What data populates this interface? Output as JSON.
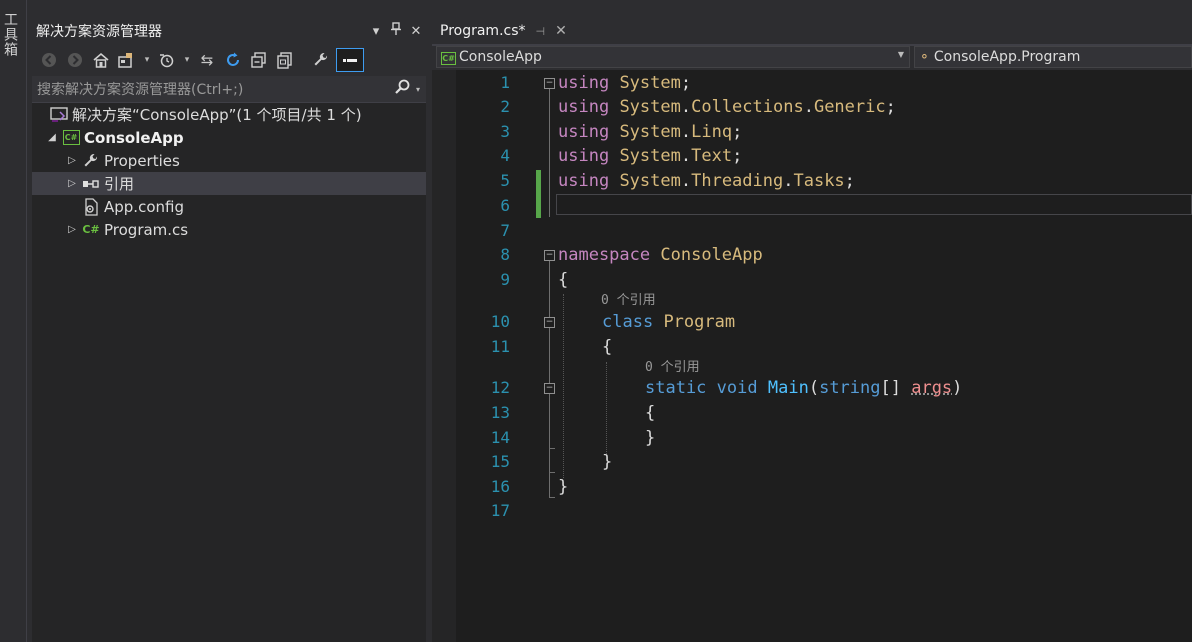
{
  "toolbox": {
    "label": "工具箱"
  },
  "solution_explorer": {
    "title": "解决方案资源管理器",
    "search_placeholder": "搜索解决方案资源管理器(Ctrl+;)",
    "tree": {
      "solution": "解决方案“ConsoleApp”(1 个项目/共 1 个)",
      "project": "ConsoleApp",
      "items": [
        {
          "label": "Properties",
          "icon": "wrench-icon"
        },
        {
          "label": "引用",
          "icon": "references-icon"
        },
        {
          "label": "App.config",
          "icon": "config-file-icon"
        },
        {
          "label": "Program.cs",
          "icon": "csharp-file-icon"
        }
      ]
    }
  },
  "editor": {
    "tab": {
      "label": "Program.cs*"
    },
    "nav": {
      "project": "ConsoleApp",
      "type": "ConsoleApp.Program"
    },
    "line_numbers": [
      "1",
      "2",
      "3",
      "4",
      "5",
      "6",
      "7",
      "8",
      "9",
      "10",
      "11",
      "12",
      "13",
      "14",
      "15",
      "16",
      "17"
    ],
    "code": {
      "l1": [
        "using",
        " ",
        "System",
        ";"
      ],
      "l2": [
        "using",
        " ",
        "System",
        ".",
        "Collections",
        ".",
        "Generic",
        ";"
      ],
      "l3": [
        "using",
        " ",
        "System",
        ".",
        "Linq",
        ";"
      ],
      "l4": [
        "using",
        " ",
        "System",
        ".",
        "Text",
        ";"
      ],
      "l5": [
        "using",
        " ",
        "System",
        ".",
        "Threading",
        ".",
        "Tasks",
        ";"
      ],
      "l8": [
        "namespace",
        " ",
        "ConsoleApp"
      ],
      "l9": "{",
      "l10": [
        "class",
        " ",
        "Program"
      ],
      "l11": "{",
      "l12": [
        "static",
        " ",
        "void",
        " ",
        "Main",
        "(",
        "string",
        "[] ",
        "args",
        ")"
      ],
      "l13": "{",
      "l14": "}",
      "l15": "}",
      "l16": "}"
    },
    "codelens": [
      "0 个引用",
      "0 个引用"
    ]
  },
  "colors": {
    "keyword": "#c586c0",
    "type_keyword": "#569cd6",
    "identifier": "#d7ba7d",
    "method": "#4fc1ff",
    "line_number": "#2b91af",
    "change_bar": "#57a64a"
  }
}
